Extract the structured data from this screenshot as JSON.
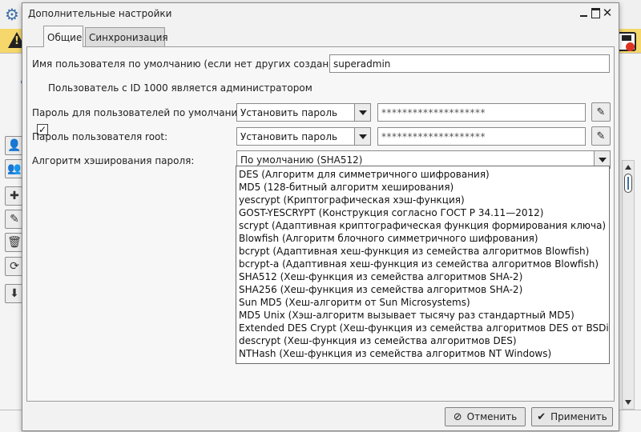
{
  "dialog": {
    "title": "Дополнительные настройки",
    "minimize_icon": "minimize-icon",
    "maximize_icon": "maximize-icon",
    "close_icon": "close-icon"
  },
  "tabs": [
    {
      "label": "Общие",
      "active": true
    },
    {
      "label": "Синхронизация",
      "active": false
    }
  ],
  "form": {
    "default_user_label": "Имя пользователя по умолчанию (если нет других созданных):",
    "default_user_value": "superadmin",
    "admin_checkbox_label": "Пользователь с ID 1000 является администратором",
    "admin_checkbox_checked": true,
    "default_password_label": "Пароль для пользователей по умолчанию:",
    "default_password_combo": "Установить пароль",
    "default_password_value": "********************",
    "root_password_label": "Пароль пользователя root:",
    "root_password_combo": "Установить пароль",
    "root_password_value": "********************",
    "hash_label": "Алгоритм хэширования пароля:",
    "hash_value": "По умолчанию (SHA512)"
  },
  "hash_options": [
    "DES (Алгоритм для симметричного шифрования)",
    "MD5 (128-битный алгоритм хеширования)",
    "yescrypt (Криптографическая хэш-функция)",
    "GOST-YESCRYPT (Конструкция согласно ГОСТ Р 34.11—2012)",
    "scrypt (Адаптивная криптографическая функция формирования ключа)",
    "Blowfish (Алгоритм блочного симметричного шифрования)",
    "bcrypt (Адаптивная хеш-функция из семейства алгоритмов Blowfish)",
    "bcrypt-a (Адаптивная хеш-функция из семейства алгоритмов Blowfish)",
    "SHA512 (Хеш-функция из семейства алгоритмов SHA-2)",
    "SHA256 (Хеш-функция из семейства алгоритмов SHA-2)",
    "Sun MD5 (Хеш-алгоритм от Sun Microsystems)",
    "MD5 Unix (Хэш-алгоритм вызывает тысячу раз стандартный MD5)",
    "Extended DES Crypt (Хеш-функция из семейства алгоритмов DES от BSDi)",
    "descrypt (Хеш-функция из семейства алгоритмов DES)",
    "NTHash (Хеш-функция из семейства алгоритмов NT Windows)"
  ],
  "buttons": {
    "cancel": "Отменить",
    "apply": "Применить"
  },
  "glyphs": {
    "gear": "⚙",
    "check": "✓",
    "pencil": "✎",
    "close": "✕",
    "cancel": "⊘",
    "apply": "✔",
    "user": "👤",
    "users": "👥",
    "plus": "✚",
    "edit": "✎",
    "trash": "🗑",
    "refresh": "⟳",
    "download": "⬇"
  }
}
